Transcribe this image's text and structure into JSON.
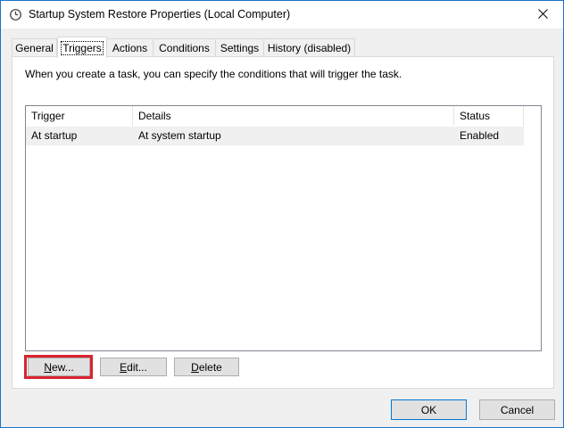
{
  "window": {
    "title": "Startup System Restore Properties (Local Computer)",
    "icons": {
      "app": "clock-icon",
      "close": "close-icon"
    }
  },
  "tabs": [
    {
      "label": "General",
      "active": false
    },
    {
      "label": "Triggers",
      "active": true
    },
    {
      "label": "Actions",
      "active": false
    },
    {
      "label": "Conditions",
      "active": false
    },
    {
      "label": "Settings",
      "active": false
    },
    {
      "label": "History (disabled)",
      "active": false
    }
  ],
  "triggers_tab": {
    "description": "When you create a task, you can specify the conditions that will trigger the task.",
    "columns": [
      "Trigger",
      "Details",
      "Status"
    ],
    "rows": [
      {
        "trigger": "At startup",
        "details": "At system startup",
        "status": "Enabled"
      }
    ],
    "buttons": {
      "new": {
        "accel": "N",
        "rest": "ew..."
      },
      "edit": {
        "accel": "E",
        "rest": "dit..."
      },
      "delete": {
        "accel": "D",
        "rest": "elete"
      }
    }
  },
  "footer": {
    "ok_label": "OK",
    "cancel_label": "Cancel"
  },
  "colors": {
    "highlight": "#d9232e",
    "focus_border": "#0078d7"
  }
}
